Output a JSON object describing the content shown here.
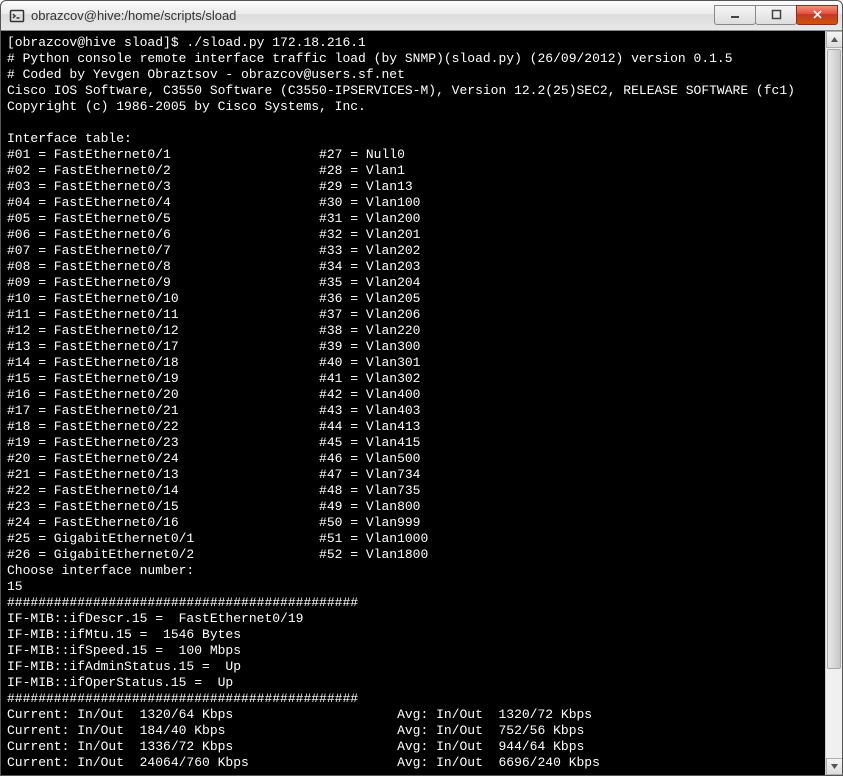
{
  "window": {
    "title": "obrazcov@hive:/home/scripts/sload"
  },
  "prompt": "[obrazcov@hive sload]$ ./sload.py 172.18.216.1",
  "header_lines": [
    "# Python console remote interface traffic load (by SNMP)(sload.py) (26/09/2012) version 0.1.5",
    "# Coded by Yevgen Obraztsov - obrazcov@users.sf.net",
    "Cisco IOS Software, C3550 Software (C3550-IPSERVICES-M), Version 12.2(25)SEC2, RELEASE SOFTWARE (fc1)",
    "Copyright (c) 1986-2005 by Cisco Systems, Inc."
  ],
  "interface_table_label": "Interface table:",
  "interface_rows": [
    {
      "lnum": "01",
      "lname": "FastEthernet0/1",
      "rnum": "27",
      "rname": "Null0"
    },
    {
      "lnum": "02",
      "lname": "FastEthernet0/2",
      "rnum": "28",
      "rname": "Vlan1"
    },
    {
      "lnum": "03",
      "lname": "FastEthernet0/3",
      "rnum": "29",
      "rname": "Vlan13"
    },
    {
      "lnum": "04",
      "lname": "FastEthernet0/4",
      "rnum": "30",
      "rname": "Vlan100"
    },
    {
      "lnum": "05",
      "lname": "FastEthernet0/5",
      "rnum": "31",
      "rname": "Vlan200"
    },
    {
      "lnum": "06",
      "lname": "FastEthernet0/6",
      "rnum": "32",
      "rname": "Vlan201"
    },
    {
      "lnum": "07",
      "lname": "FastEthernet0/7",
      "rnum": "33",
      "rname": "Vlan202"
    },
    {
      "lnum": "08",
      "lname": "FastEthernet0/8",
      "rnum": "34",
      "rname": "Vlan203"
    },
    {
      "lnum": "09",
      "lname": "FastEthernet0/9",
      "rnum": "35",
      "rname": "Vlan204"
    },
    {
      "lnum": "10",
      "lname": "FastEthernet0/10",
      "rnum": "36",
      "rname": "Vlan205"
    },
    {
      "lnum": "11",
      "lname": "FastEthernet0/11",
      "rnum": "37",
      "rname": "Vlan206"
    },
    {
      "lnum": "12",
      "lname": "FastEthernet0/12",
      "rnum": "38",
      "rname": "Vlan220"
    },
    {
      "lnum": "13",
      "lname": "FastEthernet0/17",
      "rnum": "39",
      "rname": "Vlan300"
    },
    {
      "lnum": "14",
      "lname": "FastEthernet0/18",
      "rnum": "40",
      "rname": "Vlan301"
    },
    {
      "lnum": "15",
      "lname": "FastEthernet0/19",
      "rnum": "41",
      "rname": "Vlan302"
    },
    {
      "lnum": "16",
      "lname": "FastEthernet0/20",
      "rnum": "42",
      "rname": "Vlan400"
    },
    {
      "lnum": "17",
      "lname": "FastEthernet0/21",
      "rnum": "43",
      "rname": "Vlan403"
    },
    {
      "lnum": "18",
      "lname": "FastEthernet0/22",
      "rnum": "44",
      "rname": "Vlan413"
    },
    {
      "lnum": "19",
      "lname": "FastEthernet0/23",
      "rnum": "45",
      "rname": "Vlan415"
    },
    {
      "lnum": "20",
      "lname": "FastEthernet0/24",
      "rnum": "46",
      "rname": "Vlan500"
    },
    {
      "lnum": "21",
      "lname": "FastEthernet0/13",
      "rnum": "47",
      "rname": "Vlan734"
    },
    {
      "lnum": "22",
      "lname": "FastEthernet0/14",
      "rnum": "48",
      "rname": "Vlan735"
    },
    {
      "lnum": "23",
      "lname": "FastEthernet0/15",
      "rnum": "49",
      "rname": "Vlan800"
    },
    {
      "lnum": "24",
      "lname": "FastEthernet0/16",
      "rnum": "50",
      "rname": "Vlan999"
    },
    {
      "lnum": "25",
      "lname": "GigabitEthernet0/1",
      "rnum": "51",
      "rname": "Vlan1000"
    },
    {
      "lnum": "26",
      "lname": "GigabitEthernet0/2",
      "rnum": "52",
      "rname": "Vlan1800"
    }
  ],
  "choose_prompt": "Choose interface number:",
  "chosen": "15",
  "sep": "#############################################",
  "mib_lines": [
    "IF-MIB::ifDescr.15 =  FastEthernet0/19",
    "IF-MIB::ifMtu.15 =  1546 Bytes",
    "IF-MIB::ifSpeed.15 =  100 Mbps",
    "IF-MIB::ifAdminStatus.15 =  Up",
    "IF-MIB::ifOperStatus.15 =  Up"
  ],
  "traffic_rows": [
    {
      "cur": "1320/64 Kbps",
      "avg": "1320/72 Kbps"
    },
    {
      "cur": "184/40 Kbps",
      "avg": "752/56 Kbps"
    },
    {
      "cur": "1336/72 Kbps",
      "avg": "944/64 Kbps"
    },
    {
      "cur": "24064/760 Kbps",
      "avg": "6696/240 Kbps"
    }
  ],
  "traffic_labels": {
    "current": "Current: In/Out  ",
    "avg": "Avg: In/Out  "
  }
}
